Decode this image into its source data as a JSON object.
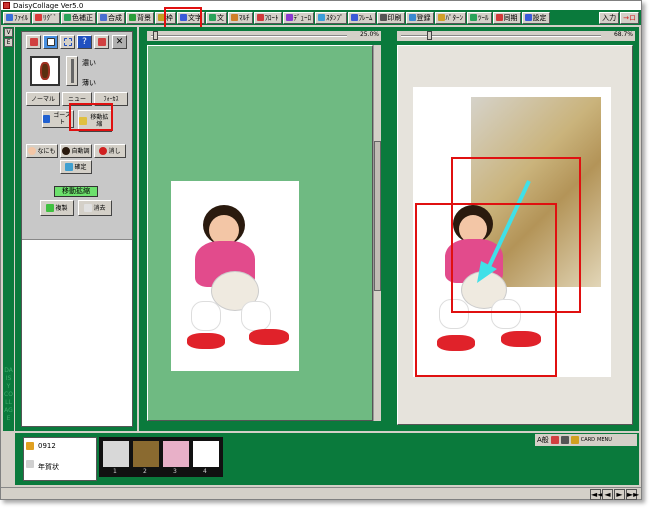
{
  "app": {
    "title": "DaisyCollage  Ver5.0"
  },
  "menu": [
    {
      "label": "ﾌｧｲﾙ",
      "color": "#3a6fd8"
    },
    {
      "label": "ﾘｸﾞﾞ",
      "color": "#d83a3a"
    },
    {
      "label": "色補正",
      "color": "#2aa35a"
    },
    {
      "label": "合成",
      "color": "#4a6fd0"
    },
    {
      "label": "背景",
      "color": "#2a9e3a"
    },
    {
      "label": "枠",
      "color": "#c2a020"
    },
    {
      "label": "文字",
      "color": "#3a5ad8"
    },
    {
      "label": "文",
      "color": "#2aa35a"
    },
    {
      "label": "ﾏﾙﾁ",
      "color": "#d0802a"
    },
    {
      "label": "ﾌﾛｰﾄ",
      "color": "#d03a3a"
    },
    {
      "label": "ﾃﾞｭｰﾛ",
      "color": "#8a3ad0"
    },
    {
      "label": "ｽﾀﾝﾌﾟ",
      "color": "#3a9ed8"
    },
    {
      "label": "ﾌﾚｰﾑ",
      "color": "#3a5ad8"
    },
    {
      "label": "印刷",
      "color": "#555555"
    },
    {
      "label": "登録",
      "color": "#3a8ad0"
    },
    {
      "label": "ﾊﾟﾀｰﾝ",
      "color": "#d0a02a"
    },
    {
      "label": "ﾂｰﾙ",
      "color": "#2aa35a"
    },
    {
      "label": "同期",
      "color": "#d03a3a"
    },
    {
      "label": "設定",
      "color": "#3a5ad8"
    }
  ],
  "menu_right": {
    "nav_label": "入力",
    "arrow_label": "→ロ"
  },
  "left_strip": {
    "btn1": "V",
    "btn2": "E",
    "vertical_text": "DAISY COLLAGE"
  },
  "tool_panel": {
    "top_buttons": [
      "rotate-icon",
      "select-rect-icon",
      "multi-select-icon",
      "help-icon",
      "move-icon",
      "close-icon"
    ],
    "dark_label": "濃い",
    "light_label": "薄い",
    "btn_normal": "ノーマル",
    "btn_new": "ニュー",
    "btn_focus": "ﾌｫｰｶｽ",
    "btn_ghost": "ゴースト",
    "btn_move": "移動拡縮",
    "btn_none": "なにも",
    "btn_auto": "自動調",
    "btn_mask": "消し",
    "btn_confirm": "確定",
    "status_label": "移動拡縮",
    "btn_copy": "複製",
    "btn_delete": "消去"
  },
  "canvas_left": {
    "zoom": "25.0%"
  },
  "canvas_right": {
    "zoom": "68.7%"
  },
  "filmstrip": {
    "folder_name": "0912",
    "album_name": "年賀状",
    "thumb_numbers": [
      "1",
      "2",
      "3",
      "4"
    ]
  },
  "bottom_tools": {
    "label": "A般",
    "labels": [
      "CARD",
      "MENU"
    ]
  },
  "statusbar": {
    "left": "",
    "nav": [
      "◄◄",
      "◄",
      "►",
      "►►"
    ]
  },
  "colors": {
    "green": "#0a7a3c",
    "canvas_green": "#6fba82",
    "highlight": "#e01010",
    "arrow": "#40e0e8"
  }
}
